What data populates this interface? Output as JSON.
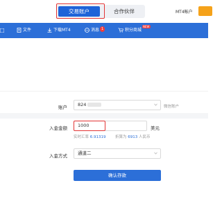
{
  "header": {
    "tabs": [
      {
        "label": "交易账户",
        "active": true
      },
      {
        "label": "合作伙伴",
        "active": false
      }
    ],
    "mt4_link": "MT4帐户"
  },
  "nav": {
    "items": [
      {
        "label": "文件",
        "icon": "file-icon"
      },
      {
        "label": "下载MT4",
        "icon": "download-icon"
      },
      {
        "label": "消息",
        "icon": "message-icon",
        "badge": "1"
      },
      {
        "label": "积分商城",
        "icon": "shop-icon",
        "badge": "NEW"
      }
    ]
  },
  "form": {
    "account": {
      "label": "账户",
      "value": "824",
      "hint": "微信账户"
    },
    "amount": {
      "label": "入金金额",
      "value": "1000",
      "unit": "美元"
    },
    "rate": {
      "prefix": "实时汇率",
      "rate": "6.91319",
      "convert_prefix": "折算为",
      "convert_value": "6913",
      "convert_unit": "人民币"
    },
    "method": {
      "label": "入金方式",
      "value": "通道二"
    },
    "submit_label": "确认存款"
  },
  "colors": {
    "primary": "#2c6fd8",
    "highlight": "#e23434",
    "accent": "#f5a21a"
  }
}
